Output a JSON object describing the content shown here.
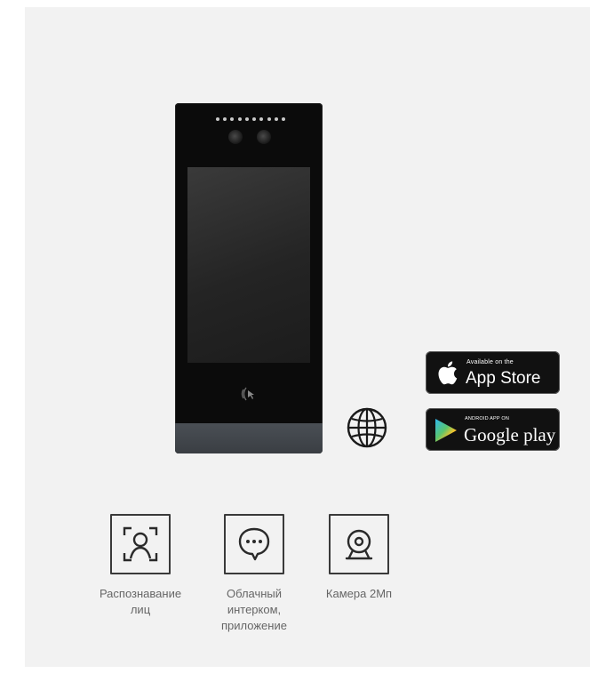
{
  "app_store": {
    "small_text": "Available on the",
    "big_text": "App Store",
    "icon": "apple-icon"
  },
  "google_play": {
    "small_text": "ANDROID APP ON",
    "big_text": "Google play",
    "icon": "play-triangle-icon"
  },
  "globe": {
    "icon": "globe-icon"
  },
  "features": [
    {
      "label_line1": "Распознавание",
      "label_line2": "лиц",
      "icon": "face-recognition-icon"
    },
    {
      "label_line1": "Облачный",
      "label_line2": "интерком,",
      "label_line3": "приложение",
      "icon": "chat-bubble-icon"
    },
    {
      "label_line1": "Камера 2Мп",
      "icon": "webcam-icon"
    }
  ],
  "colors": {
    "background": "#f2f2f2",
    "device_body": "#0b0b0b",
    "device_base": "#454a50",
    "badge_background": "#111111",
    "icon_stroke": "#3a3a3a",
    "label_text": "#666666"
  }
}
